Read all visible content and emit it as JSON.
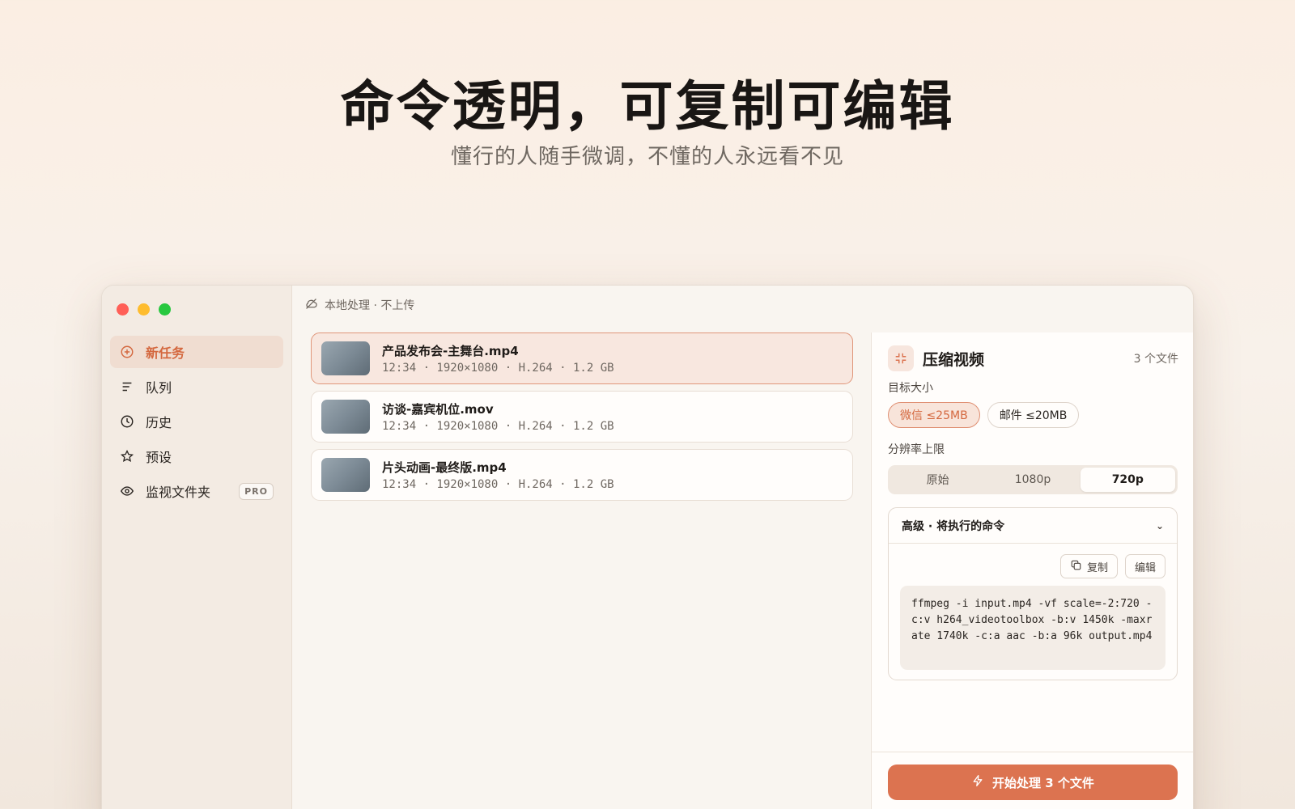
{
  "hero": {
    "title": "命令透明，可复制可编辑",
    "subtitle": "懂行的人随手微调，不懂的人永远看不见"
  },
  "window": {
    "sidebar": {
      "items": [
        {
          "label": "新任务",
          "icon": "plus-circle-icon",
          "active": true
        },
        {
          "label": "队列",
          "icon": "list-icon",
          "active": false
        },
        {
          "label": "历史",
          "icon": "clock-icon",
          "active": false
        },
        {
          "label": "预设",
          "icon": "star-icon",
          "active": false
        },
        {
          "label": "监视文件夹",
          "icon": "eye-icon",
          "active": false,
          "badge": "PRO"
        }
      ]
    },
    "topbar": {
      "status": "本地处理 · 不上传",
      "icon": "cloud-off-icon"
    },
    "files": [
      {
        "name": "产品发布会-主舞台.mp4",
        "meta": "12:34 · 1920×1080 · H.264 · 1.2 GB",
        "selected": true
      },
      {
        "name": "访谈-嘉宾机位.mov",
        "meta": "12:34 · 1920×1080 · H.264 · 1.2 GB",
        "selected": false
      },
      {
        "name": "片头动画-最终版.mp4",
        "meta": "12:34 · 1920×1080 · H.264 · 1.2 GB",
        "selected": false
      }
    ],
    "panel": {
      "title": "压缩视频",
      "icon": "compress-icon",
      "file_count": "3 个文件",
      "target_label": "目标大小",
      "target_options": [
        {
          "label": "微信 ≤25MB",
          "active": true
        },
        {
          "label": "邮件 ≤20MB",
          "active": false
        }
      ],
      "resolution_label": "分辨率上限",
      "resolution_options": [
        {
          "label": "原始",
          "active": false
        },
        {
          "label": "1080p",
          "active": false
        },
        {
          "label": "720p",
          "active": true
        }
      ],
      "advanced": {
        "title": "高级 · 将执行的命令",
        "chevron": "⌄",
        "copy_label": "复制",
        "edit_label": "编辑",
        "command": "ffmpeg -i input.mp4 -vf scale=-2:720 -c:v h264_videotoolbox -b:v 1450k -maxrate 1740k -c:a aac -b:a 96k output.mp4"
      },
      "start_label": "开始处理 3 个文件"
    }
  },
  "colors": {
    "accent": "#dc7350",
    "accent_text": "#d4683f",
    "selected_bg": "#f8e7df"
  }
}
